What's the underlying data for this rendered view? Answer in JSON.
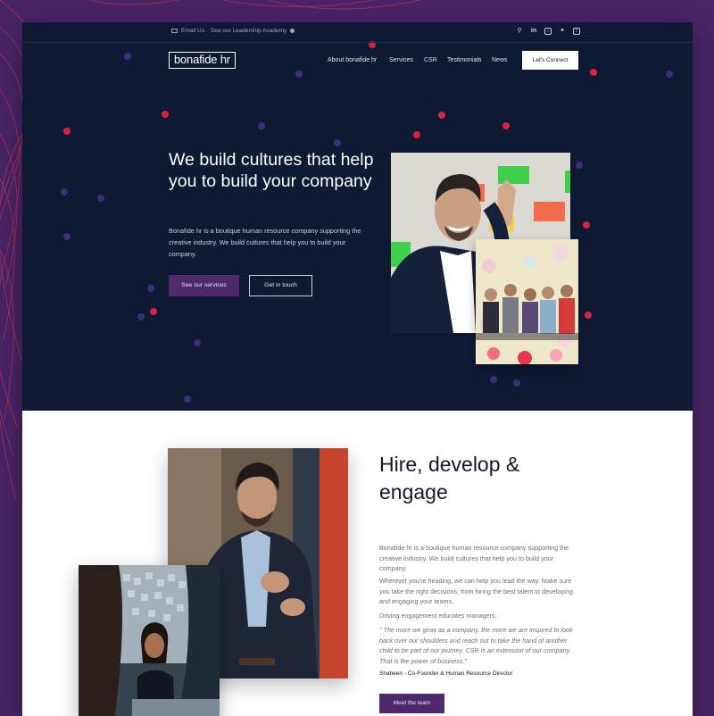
{
  "topbar": {
    "email_label": "Email Us",
    "academy_label": "See our Leadership Academy",
    "social_icons": [
      "search-icon",
      "linkedin-icon",
      "instagram-icon",
      "twitter-icon",
      "facebook-icon"
    ]
  },
  "header": {
    "logo": "bonafide hr",
    "nav": [
      "About bonafide hr",
      "Services",
      "CSR",
      "Testimonials",
      "News"
    ],
    "cta": "Let's Connect"
  },
  "hero": {
    "title": "We build cultures that help you to build your company",
    "text": "Bonafide hr is a boutique human resource company supporting the creative industry. We build cultures that help you to build your company.",
    "primary_button": "See our services",
    "secondary_button": "Get in touch"
  },
  "section2": {
    "heading": "Hire, develop & engage",
    "paragraph1": "Bonafide hr is a boutique human resource company supporting the creative industry. We build cultures that help you to build your company.",
    "paragraph2": "Wherever you're heading, we can help you lead the way. Make sure you take the right decisions, from hiring the best talent to developing and engaging your teams.",
    "paragraph3": "Driving engagement educates managers.",
    "quote": "\" The more we grow as a company, the more we are inspired to look back over our shoulders and reach out to take the hand of another child to be part of our journey. CSR is an extension of our company. That is the power of business.\"",
    "signature": "Shaheen - Co-Founder & Human Resource Director",
    "button": "Meet the team"
  },
  "colors": {
    "page_bg": "#4a2466",
    "hero_bg": "#0e1a33",
    "accent_purple": "#4e2a6d",
    "dot_red": "#d8243c",
    "dot_purple": "#3f2d7a"
  }
}
